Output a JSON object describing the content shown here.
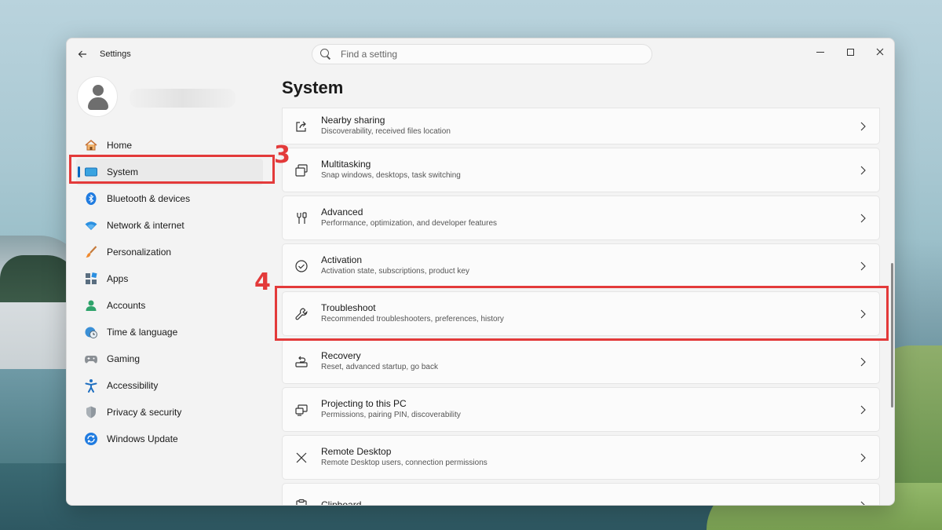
{
  "window": {
    "app_title": "Settings",
    "search_placeholder": "Find a setting"
  },
  "sidebar": {
    "items": [
      {
        "label": "Home",
        "icon": "home-icon",
        "active": false
      },
      {
        "label": "System",
        "icon": "system-icon",
        "active": true
      },
      {
        "label": "Bluetooth & devices",
        "icon": "bluetooth-icon",
        "active": false
      },
      {
        "label": "Network & internet",
        "icon": "wifi-icon",
        "active": false
      },
      {
        "label": "Personalization",
        "icon": "brush-icon",
        "active": false
      },
      {
        "label": "Apps",
        "icon": "apps-icon",
        "active": false
      },
      {
        "label": "Accounts",
        "icon": "accounts-icon",
        "active": false
      },
      {
        "label": "Time & language",
        "icon": "globe-clock-icon",
        "active": false
      },
      {
        "label": "Gaming",
        "icon": "gamepad-icon",
        "active": false
      },
      {
        "label": "Accessibility",
        "icon": "accessibility-icon",
        "active": false
      },
      {
        "label": "Privacy & security",
        "icon": "shield-icon",
        "active": false
      },
      {
        "label": "Windows Update",
        "icon": "update-icon",
        "active": false
      }
    ]
  },
  "main": {
    "title": "System",
    "rows": [
      {
        "title": "Nearby sharing",
        "subtitle": "Discoverability, received files location",
        "icon": "share-icon"
      },
      {
        "title": "Multitasking",
        "subtitle": "Snap windows, desktops, task switching",
        "icon": "multitasking-icon"
      },
      {
        "title": "Advanced",
        "subtitle": "Performance, optimization, and developer features",
        "icon": "tools-icon"
      },
      {
        "title": "Activation",
        "subtitle": "Activation state, subscriptions, product key",
        "icon": "check-circle-icon"
      },
      {
        "title": "Troubleshoot",
        "subtitle": "Recommended troubleshooters, preferences, history",
        "icon": "wrench-icon"
      },
      {
        "title": "Recovery",
        "subtitle": "Reset, advanced startup, go back",
        "icon": "recovery-icon"
      },
      {
        "title": "Projecting to this PC",
        "subtitle": "Permissions, pairing PIN, discoverability",
        "icon": "projecting-icon"
      },
      {
        "title": "Remote Desktop",
        "subtitle": "Remote Desktop users, connection permissions",
        "icon": "remote-desktop-icon"
      },
      {
        "title": "Clipboard",
        "subtitle": "",
        "icon": "clipboard-icon"
      }
    ]
  },
  "annotations": {
    "step_3": "3",
    "step_4": "4",
    "color": "#e33a3a"
  }
}
